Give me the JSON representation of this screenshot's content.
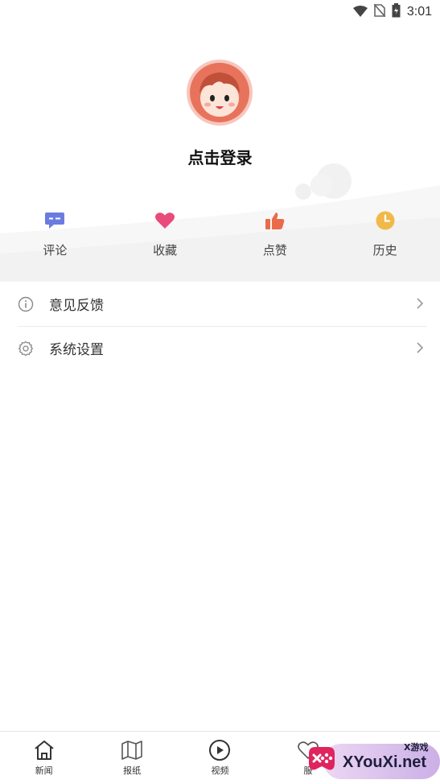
{
  "status_bar": {
    "time": "3:01",
    "icons": [
      "wifi-icon",
      "no-sim-icon",
      "battery-icon"
    ]
  },
  "profile": {
    "login_text": "点击登录",
    "avatar_icon": "avatar-cartoon-boy"
  },
  "quick_actions": [
    {
      "label": "评论",
      "icon": "comment-icon",
      "color": "#6b7ce0"
    },
    {
      "label": "收藏",
      "icon": "heart-icon",
      "color": "#e94b7a"
    },
    {
      "label": "点赞",
      "icon": "thumbs-up-icon",
      "color": "#ea6b4a"
    },
    {
      "label": "历史",
      "icon": "clock-icon",
      "color": "#f0b94a"
    }
  ],
  "menu": [
    {
      "label": "意见反馈",
      "icon": "info-icon"
    },
    {
      "label": "系统设置",
      "icon": "gear-icon"
    }
  ],
  "bottom_nav": [
    {
      "label": "新闻",
      "icon": "home-icon"
    },
    {
      "label": "报纸",
      "icon": "map-icon"
    },
    {
      "label": "视频",
      "icon": "play-icon"
    },
    {
      "label": "服",
      "icon": "heart-outline-icon"
    }
  ],
  "watermark": {
    "main": "XYouXi.net",
    "small": "X游戏"
  }
}
